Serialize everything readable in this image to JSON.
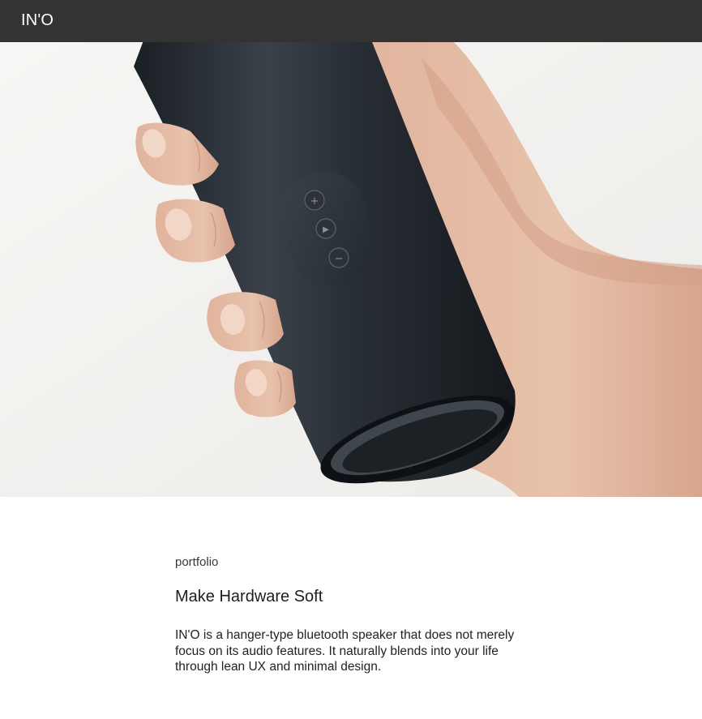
{
  "header": {
    "brand": "IN'O"
  },
  "hero": {
    "image_icon": "speaker-in-hand-photo",
    "buttons": [
      "plus-icon",
      "play-icon",
      "minus-icon"
    ]
  },
  "content": {
    "section_label": "portfolio",
    "headline": "Make Hardware Soft",
    "description": "IN'O is a hanger-type bluetooth speaker that does not merely focus on its audio features. It naturally blends into your life through lean UX and minimal design."
  },
  "colors": {
    "header_bg": "#333333",
    "page_bg": "#ffffff",
    "speaker": "#23292f"
  }
}
